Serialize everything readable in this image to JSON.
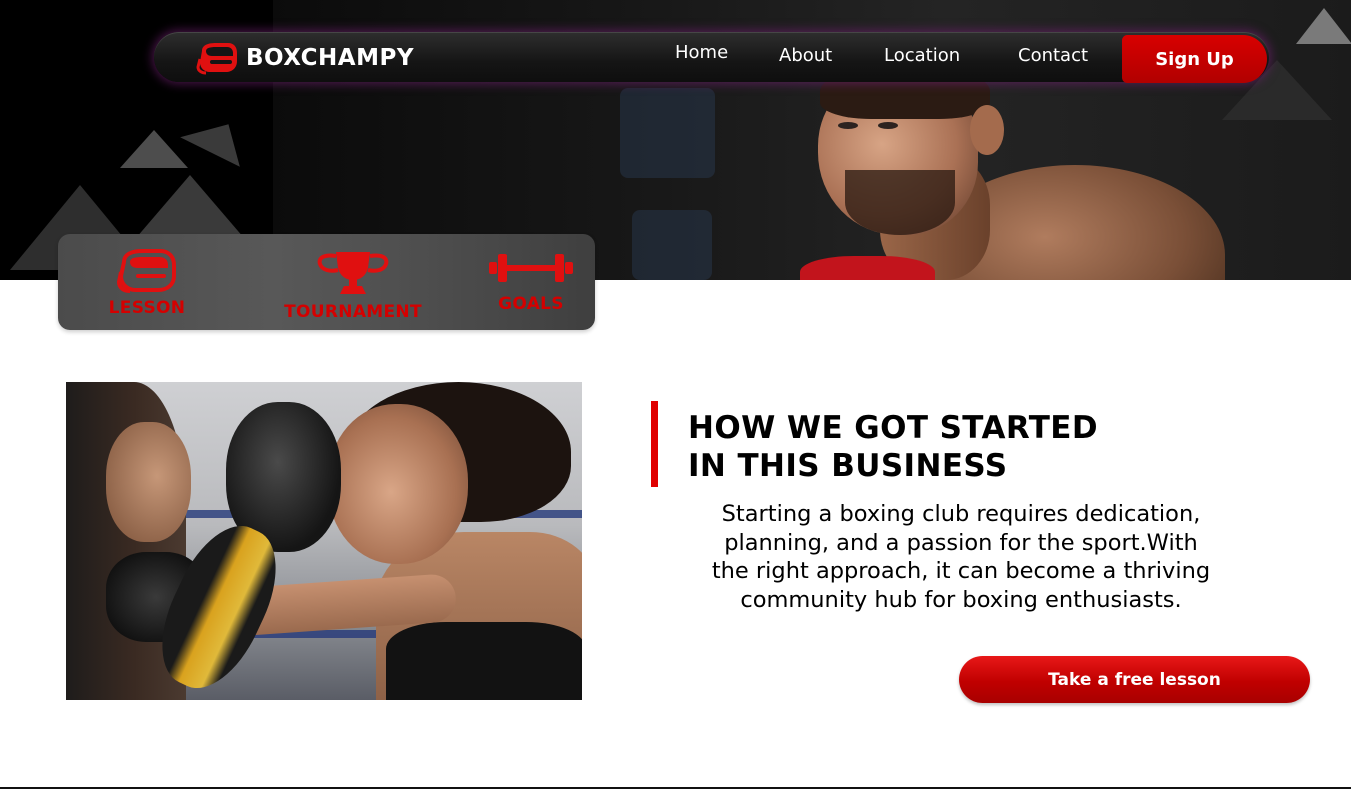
{
  "brand": {
    "name": "BOXCHAMPY",
    "accent": "#d40000",
    "logo_icon": "boxing-glove-icon"
  },
  "nav": {
    "links": [
      {
        "label": "Home"
      },
      {
        "label": "About"
      },
      {
        "label": "Location"
      },
      {
        "label": "Contact"
      }
    ],
    "signup_label": "Sign Up"
  },
  "features": [
    {
      "label": "LESSON",
      "icon": "boxing-glove-icon"
    },
    {
      "label": "TOURNAMENT",
      "icon": "trophy-icon"
    },
    {
      "label": "GOALS",
      "icon": "dumbbell-icon"
    }
  ],
  "about": {
    "heading_lines": [
      "HOW WE GOT STARTED",
      "IN THIS BUSINESS"
    ],
    "body_lines": [
      "Starting a boxing club requires dedication,",
      "planning, and a passion for the sport.With",
      "the right approach, it can become a thriving",
      "community hub for boxing enthusiasts."
    ],
    "cta_label": "Take a free lesson"
  }
}
